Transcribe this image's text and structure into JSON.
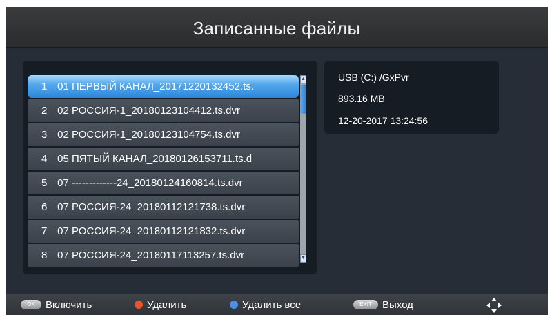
{
  "screen": {
    "title": "Записанные файлы"
  },
  "files": [
    {
      "num": "1",
      "name": "01 ПЕРВЫЙ КАНАЛ_20171220132452.ts."
    },
    {
      "num": "2",
      "name": "02 РОССИЯ-1_20180123104412.ts.dvr"
    },
    {
      "num": "3",
      "name": "02 РОССИЯ-1_20180123104754.ts.dvr"
    },
    {
      "num": "4",
      "name": "05 ПЯТЫЙ КАНАЛ_20180126153711.ts.d"
    },
    {
      "num": "5",
      "name": "07 -------------24_20180124160814.ts.dvr"
    },
    {
      "num": "6",
      "name": "07 РОССИЯ-24_20180112121738.ts.dvr"
    },
    {
      "num": "7",
      "name": "07 РОССИЯ-24_20180112121832.ts.dvr"
    },
    {
      "num": "8",
      "name": "07 РОССИЯ-24_20180117113257.ts.dvr"
    }
  ],
  "selected_index": 0,
  "info": {
    "path": "USB (C:) /GxPvr",
    "size": "893.16 MB",
    "datetime": "12-20-2017 13:24:56"
  },
  "footer": {
    "ok_key": "OK",
    "ok_label": "Включить",
    "delete_label": "Удалить",
    "delete_all_label": "Удалить все",
    "exit_key": "EXIT",
    "exit_label": "Выход"
  },
  "colors": {
    "delete_dot": "#e8552a",
    "delete_all_dot": "#4f8fe6",
    "selected_row": "#3b92df"
  },
  "icons": {
    "scroll_up": "scroll-up-arrow-icon",
    "scroll_down": "scroll-down-arrow-icon",
    "navigation": "navigation-diamond-icon"
  }
}
